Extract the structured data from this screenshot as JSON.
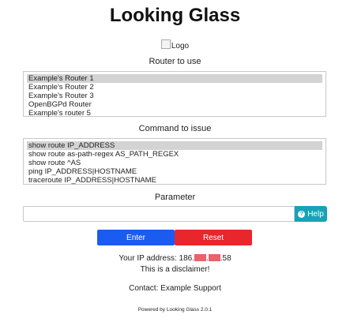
{
  "header": {
    "title": "Looking Glass"
  },
  "logo": {
    "alt_text": "Logo"
  },
  "router_section": {
    "label": "Router to use",
    "options": [
      "Example's Router 1",
      "Example's Router 2",
      "Example's Router 3",
      "OpenBGPd Router",
      "Example's router 5"
    ],
    "selected_index": 0
  },
  "command_section": {
    "label": "Command to issue",
    "options": [
      "show route IP_ADDRESS",
      "show route as-path-regex AS_PATH_REGEX",
      "show route ^AS",
      "ping IP_ADDRESS|HOSTNAME",
      "traceroute IP_ADDRESS|HOSTNAME"
    ],
    "selected_index": 0
  },
  "parameter": {
    "label": "Parameter",
    "value": "",
    "help_label": "Help",
    "help_icon": "question-circle-icon"
  },
  "actions": {
    "enter_label": "Enter",
    "reset_label": "Reset"
  },
  "info": {
    "ip_prefix": "Your IP address: 186.",
    "ip_dot1": ".",
    "ip_suffix": ".58",
    "disclaimer": "This is a disclaimer!",
    "contact": "Contact: Example Support",
    "powered_by": "Powered by Looking Glass 2.0.1"
  },
  "colors": {
    "enter": "#1a5cf0",
    "reset": "#e8262b",
    "help": "#17a2b8",
    "selected_option": "#d3d3d3"
  }
}
